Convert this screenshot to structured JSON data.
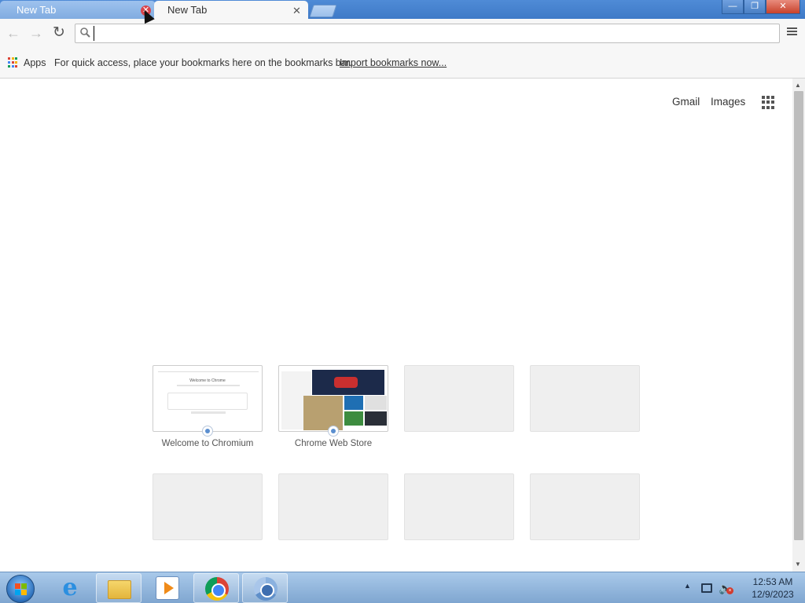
{
  "browser": {
    "tabs": [
      {
        "label": "New Tab",
        "close_glyph": "✕",
        "state": "inactive",
        "close_hovered": true
      },
      {
        "label": "New Tab",
        "close_glyph": "✕",
        "state": "active"
      }
    ],
    "window_buttons": {
      "minimize": "—",
      "restore": "❐",
      "close": "✕"
    },
    "omnibox": {
      "value": "",
      "placeholder": "",
      "icon": "search-icon"
    },
    "nav": {
      "back": "←",
      "forward": "→",
      "reload": "↻"
    }
  },
  "bookmarks_bar": {
    "apps_label": "Apps",
    "hint": "For quick access, place your bookmarks here on the bookmarks bar.",
    "import_link": "Import bookmarks now..."
  },
  "new_tab_page": {
    "top_links": {
      "gmail": "Gmail",
      "images": "Images"
    },
    "most_visited": [
      {
        "title": "Welcome to Chromium",
        "thumbnail_title": "Welcome to Chrome",
        "filled": true
      },
      {
        "title": "Chrome Web Store",
        "filled": true
      },
      {
        "title": "",
        "filled": false
      },
      {
        "title": "",
        "filled": false
      },
      {
        "title": "",
        "filled": false
      },
      {
        "title": "",
        "filled": false
      },
      {
        "title": "",
        "filled": false
      },
      {
        "title": "",
        "filled": false
      }
    ]
  },
  "taskbar": {
    "pinned": [
      "windows-start",
      "internet-explorer-icon",
      "windows-explorer-icon",
      "media-player-icon",
      "chrome-icon",
      "chromium-icon"
    ],
    "clock": {
      "time": "12:53 AM",
      "date": "12/9/2023"
    },
    "tray_glyphs": {
      "show_hidden": "▲",
      "volume": "🔈",
      "volume_muted": "×"
    }
  },
  "colors": {
    "title_bar": "#3d78c6",
    "toolbar": "#f7f7f7",
    "apps_dots": [
      "#db4437",
      "#f4b400",
      "#0f9d58",
      "#4285f4",
      "#db4437",
      "#f4b400",
      "#0f9d58",
      "#4285f4",
      "#db4437"
    ]
  }
}
